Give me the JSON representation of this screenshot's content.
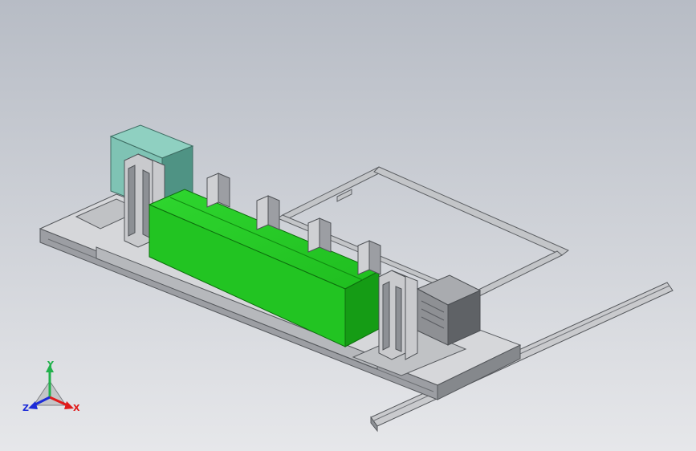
{
  "viewport": {
    "background_top": "#b7bcc5",
    "background_bottom": "#e6e7ea"
  },
  "model": {
    "colors": {
      "steel_light": "#d9dadc",
      "steel_mid": "#b4b6ba",
      "steel_dark": "#7c7f84",
      "tank_green": "#21c521",
      "tank_green_dark": "#129a12",
      "cabinet_teal": "#7fc3b4",
      "cabinet_teal_dark": "#4f9384",
      "motor_grey": "#8e9094"
    }
  },
  "triad": {
    "x_label": "X",
    "y_label": "Y",
    "z_label": "Z",
    "x_color": "#e01b1b",
    "y_color": "#22b14c",
    "z_color": "#1c2bd8"
  }
}
